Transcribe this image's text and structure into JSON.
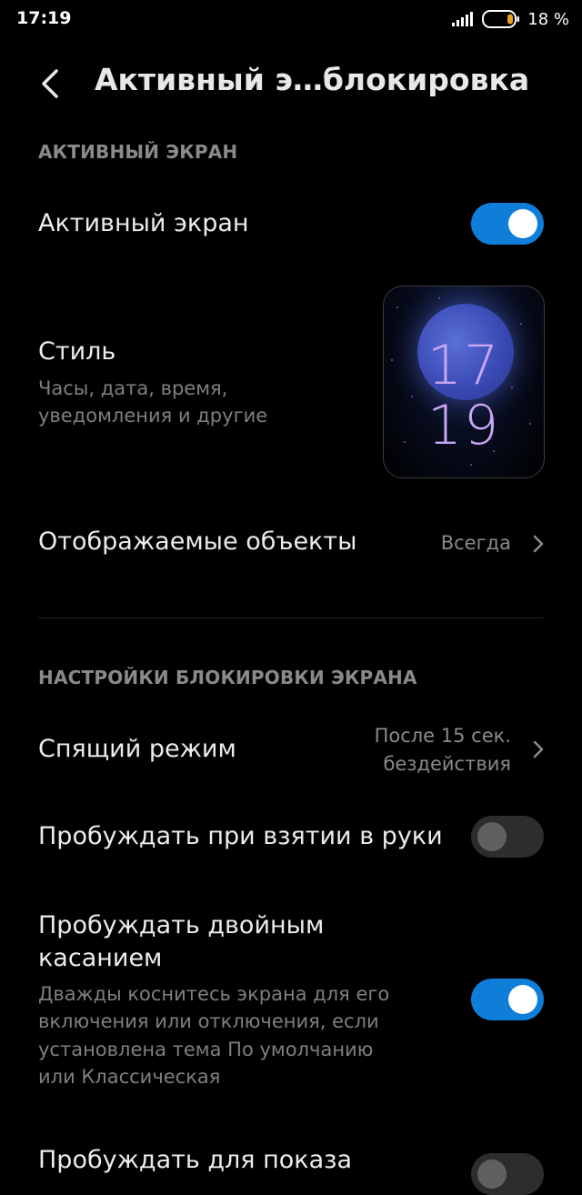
{
  "status_bar": {
    "time": "17:19",
    "battery": "18 %"
  },
  "header": {
    "title": "Активный э…блокировка"
  },
  "active_screen": {
    "section_label": "АКТИВНЫЙ ЭКРАН",
    "toggle_label": "Активный экран",
    "toggle_on": true,
    "style": {
      "title": "Стиль",
      "subtitle_line1": "Часы, дата, время,",
      "subtitle_line2": "уведомления и другие",
      "preview_hours": "17",
      "preview_minutes": "19"
    },
    "displayed_objects": {
      "label": "Отображаемые объекты",
      "value": "Всегда"
    }
  },
  "lock_settings": {
    "section_label": "НАСТРОЙКИ БЛОКИРОВКИ ЭКРАНА",
    "sleep": {
      "label": "Спящий режим",
      "value_line1": "После 15 сек.",
      "value_line2": "бездействия"
    },
    "wake_pickup": {
      "label": "Пробуждать при взятии в руки",
      "toggle_on": false
    },
    "wake_double_tap": {
      "label_line1": "Пробуждать двойным",
      "label_line2": "касанием",
      "desc_line1": "Дважды коснитесь экрана для его",
      "desc_line2": "включения или отключения, если",
      "desc_line3": "установлена тема По умолчанию",
      "desc_line4": "или Классическая",
      "toggle_on": true
    },
    "wake_notifications": {
      "label": "Пробуждать для показа"
    }
  },
  "colors": {
    "accent": "#0f7ed9",
    "background": "#000000",
    "preview_digits": "#c9a7f5"
  }
}
